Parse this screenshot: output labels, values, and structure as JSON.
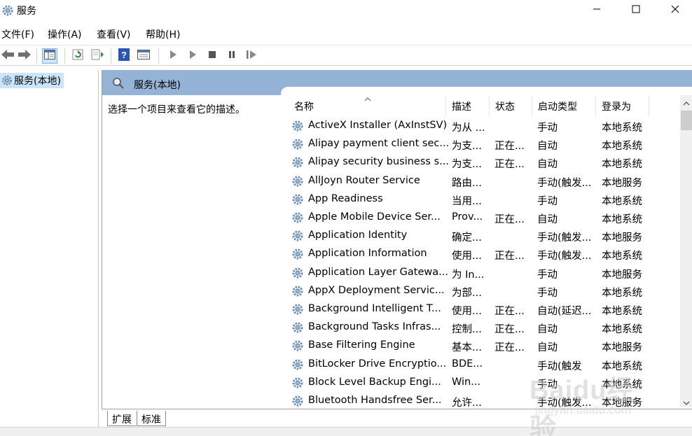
{
  "window": {
    "title": "服务",
    "icon": "gear-icon",
    "controls": [
      "minimize-icon",
      "maximize-icon",
      "close-icon"
    ]
  },
  "menu": [
    "文件(F)",
    "操作(A)",
    "查看(V)",
    "帮助(H)"
  ],
  "toolbar": {
    "icons": [
      "back-arrow-icon",
      "forward-arrow-icon",
      "show-hide-tree-icon",
      "refresh-icon",
      "export-list-icon",
      "help-icon",
      "properties-icon",
      "start-service-icon",
      "start-service-alt-icon",
      "stop-service-icon",
      "pause-service-icon",
      "resume-service-icon"
    ]
  },
  "tree": {
    "selected": "服务(本地)"
  },
  "pane": {
    "header": "服务(本地)",
    "description": "选择一个项目来查看它的描述。"
  },
  "columns": [
    "名称",
    "描述",
    "状态",
    "启动类型",
    "登录为"
  ],
  "rows": [
    {
      "name": "ActiveX Installer (AxInstSV)",
      "desc": "为从 ...",
      "status": "",
      "start": "手动",
      "logon": "本地系统"
    },
    {
      "name": "Alipay payment client sec...",
      "desc": "为支...",
      "status": "正在...",
      "start": "自动",
      "logon": "本地系统"
    },
    {
      "name": "Alipay security business s...",
      "desc": "为支...",
      "status": "正在...",
      "start": "自动",
      "logon": "本地系统"
    },
    {
      "name": "AllJoyn Router Service",
      "desc": "路由...",
      "status": "",
      "start": "手动(触发...",
      "logon": "本地服务"
    },
    {
      "name": "App Readiness",
      "desc": "当用...",
      "status": "",
      "start": "手动",
      "logon": "本地系统"
    },
    {
      "name": "Apple Mobile Device Ser...",
      "desc": "Prov...",
      "status": "正在...",
      "start": "自动",
      "logon": "本地系统"
    },
    {
      "name": "Application Identity",
      "desc": "确定...",
      "status": "",
      "start": "手动(触发...",
      "logon": "本地服务"
    },
    {
      "name": "Application Information",
      "desc": "使用...",
      "status": "正在...",
      "start": "手动(触发...",
      "logon": "本地系统"
    },
    {
      "name": "Application Layer Gatewa...",
      "desc": "为 In...",
      "status": "",
      "start": "手动",
      "logon": "本地服务"
    },
    {
      "name": "AppX Deployment Servic...",
      "desc": "为部...",
      "status": "",
      "start": "手动",
      "logon": "本地系统"
    },
    {
      "name": "Background Intelligent T...",
      "desc": "使用...",
      "status": "正在...",
      "start": "自动(延迟...",
      "logon": "本地系统"
    },
    {
      "name": "Background Tasks Infras...",
      "desc": "控制...",
      "status": "正在...",
      "start": "自动",
      "logon": "本地系统"
    },
    {
      "name": "Base Filtering Engine",
      "desc": "基本...",
      "status": "正在...",
      "start": "自动",
      "logon": "本地服务"
    },
    {
      "name": "BitLocker Drive Encryptio...",
      "desc": "BDE...",
      "status": "",
      "start": "手动(触发",
      "logon": "本地系统"
    },
    {
      "name": "Block Level Backup Engi...",
      "desc": "Win...",
      "status": "",
      "start": "手动",
      "logon": "本地系统"
    },
    {
      "name": "Bluetooth Handsfree Ser...",
      "desc": "允许...",
      "status": "",
      "start": "手动(触发...",
      "logon": "本地服务"
    }
  ],
  "tabs": [
    "扩展",
    "标准"
  ],
  "watermark": {
    "line1": "Baidu经验",
    "line2": "jingyan.baidu.com"
  },
  "colors": {
    "pane_header": "#95b3d7",
    "selection": "#cce4f7"
  }
}
